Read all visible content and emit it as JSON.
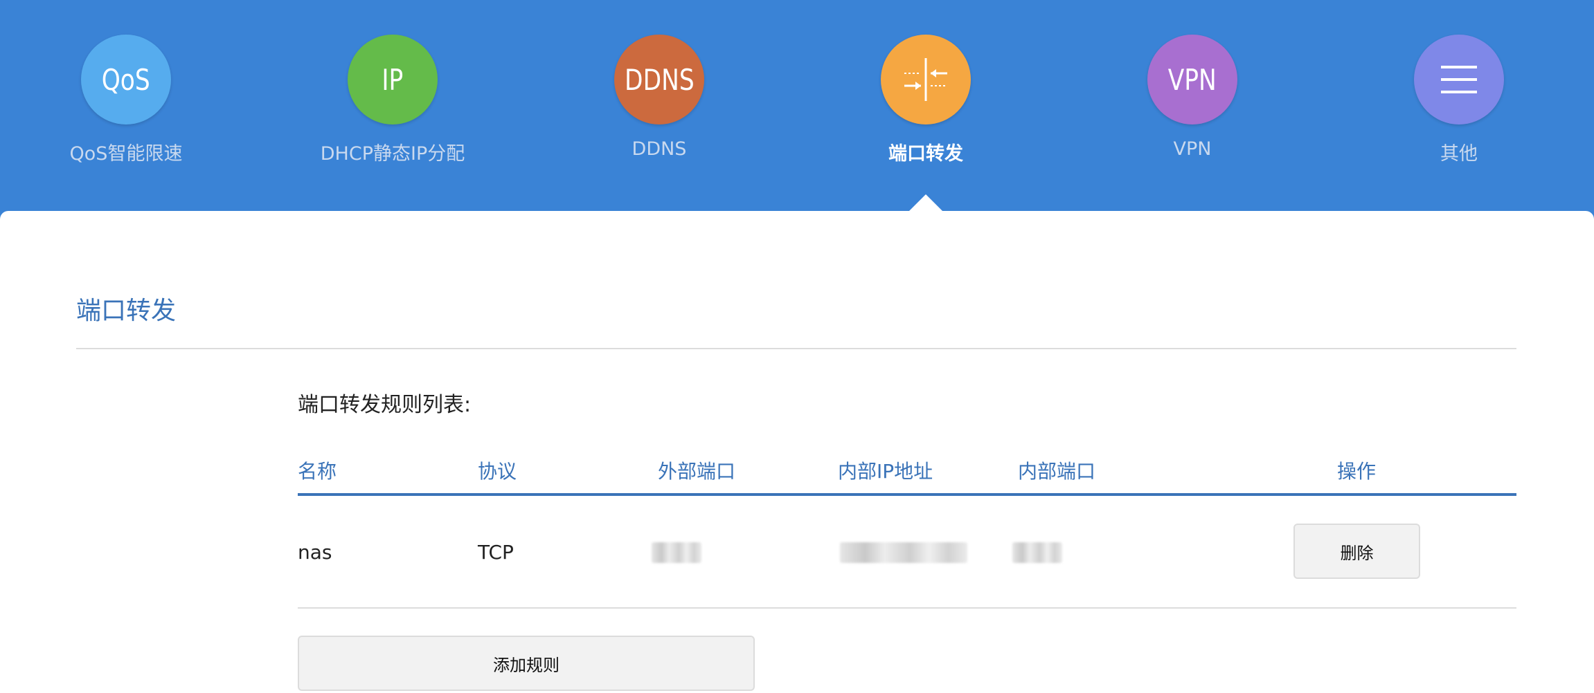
{
  "nav": {
    "items": [
      {
        "icon_text": "QoS",
        "label": "QoS智能限速",
        "color": "#56acee",
        "icon": "qos-icon"
      },
      {
        "icon_text": "IP",
        "label": "DHCP静态IP分配",
        "color": "#64bb4a",
        "icon": "ip-icon"
      },
      {
        "icon_text": "DDNS",
        "label": "DDNS",
        "color": "#cc6a3e",
        "icon": "ddns-icon"
      },
      {
        "icon_text": "",
        "label": "端口转发",
        "color": "#f5a742",
        "icon": "port-forward-icon",
        "active": true
      },
      {
        "icon_text": "VPN",
        "label": "VPN",
        "color": "#a86fd0",
        "icon": "vpn-icon"
      },
      {
        "icon_text": "",
        "label": "其他",
        "color": "#7f88e8",
        "icon": "menu-icon"
      }
    ]
  },
  "page": {
    "title": "端口转发",
    "section_label": "端口转发规则列表:"
  },
  "table": {
    "headers": [
      "名称",
      "协议",
      "外部端口",
      "内部IP地址",
      "内部端口",
      "操作"
    ],
    "rows": [
      {
        "name": "nas",
        "protocol": "TCP",
        "delete_label": "删除"
      }
    ]
  },
  "actions": {
    "add_rule_label": "添加规则"
  },
  "colors": {
    "header_bg": "#3a83d6",
    "accent": "#3a73b8"
  }
}
